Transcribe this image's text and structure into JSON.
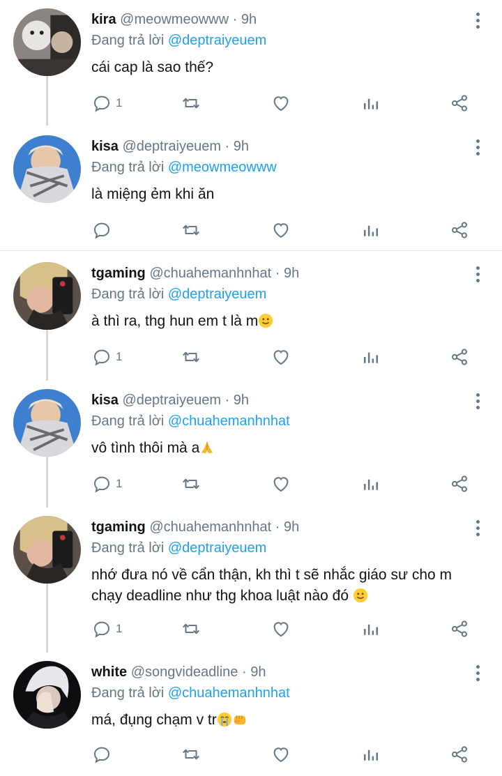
{
  "reply_prefix": "Đang trả lời",
  "dot": "·",
  "tweets": [
    {
      "name": "kira",
      "handle": "@meowmeowww",
      "time": "9h",
      "reply_to": "@deptraiyeuem",
      "text": "cái cap là sao thế?",
      "reply_count": "1"
    },
    {
      "name": "kisa",
      "handle": "@deptraiyeuem",
      "time": "9h",
      "reply_to": "@meowmeowww",
      "text": "là miệng ẻm khi ăn",
      "reply_count": ""
    },
    {
      "name": "tgaming",
      "handle": "@chuahemanhnhat",
      "time": "9h",
      "reply_to": "@deptraiyeuem",
      "text": "à thì ra, thg hun em t là m",
      "reply_count": "1"
    },
    {
      "name": "kisa",
      "handle": "@deptraiyeuem",
      "time": "9h",
      "reply_to": "@chuahemanhnhat",
      "text": "vô tình thôi mà a",
      "reply_count": "1"
    },
    {
      "name": "tgaming",
      "handle": "@chuahemanhnhat",
      "time": "9h",
      "reply_to": "@deptraiyeuem",
      "text": "nhớ đưa nó về cẩn thận, kh thì t sẽ nhắc giáo sư cho m chạy deadline như thg khoa luật nào đó",
      "reply_count": "1"
    },
    {
      "name": "white",
      "handle": "@songvideadline",
      "time": "9h",
      "reply_to": "@chuahemanhnhat",
      "text": "má, đụng chạm v tr",
      "reply_count": ""
    }
  ],
  "colors": {
    "link": "#1da1f2",
    "secondary": "#657786",
    "text": "#0f1419"
  },
  "icons": [
    "reply-icon",
    "retweet-icon",
    "like-icon",
    "analytics-icon",
    "share-icon",
    "more-icon"
  ]
}
